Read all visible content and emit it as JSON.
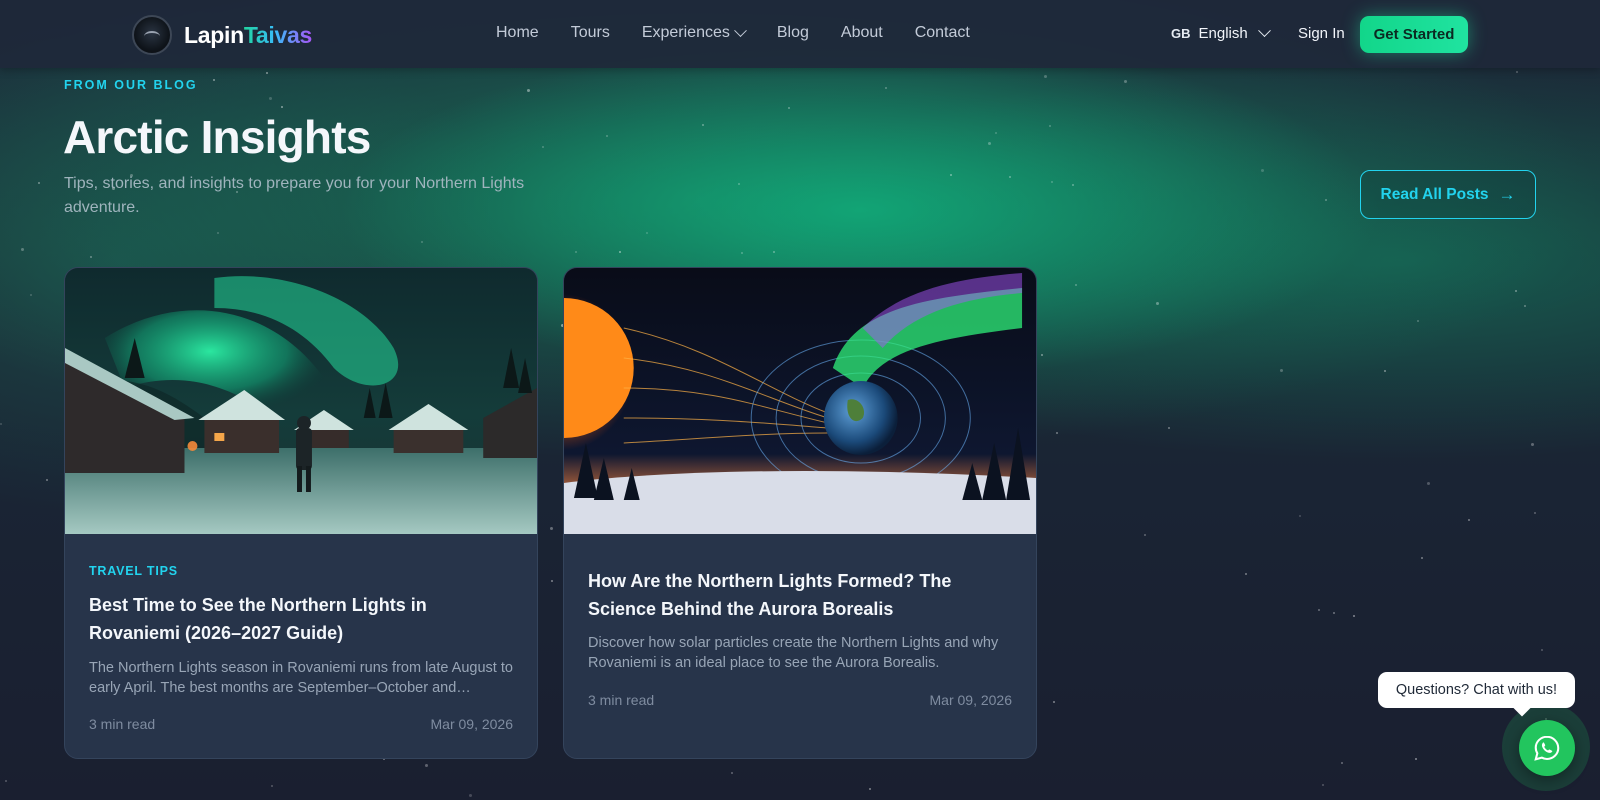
{
  "nav": {
    "logo_part1": "Lapin",
    "logo_part2": "Taivas",
    "menu": [
      {
        "label": "Home"
      },
      {
        "label": "Tours"
      },
      {
        "label": "Experiences"
      },
      {
        "label": "Blog"
      },
      {
        "label": "About"
      },
      {
        "label": "Contact"
      }
    ],
    "language_code": "GB",
    "language": "English",
    "sign_in": "Sign In",
    "get_started": "Get Started"
  },
  "section": {
    "eyebrow": "FROM OUR BLOG",
    "title": "Arctic Insights",
    "subtitle": "Tips, stories, and insights to prepare you for your Northern Lights adventure.",
    "read_all": "Read All Posts",
    "read_all_arrow": "→"
  },
  "posts": [
    {
      "category": "TRAVEL TIPS",
      "title": "Best Time to See the Northern Lights in Rovaniemi (2026–2027 Guide)",
      "excerpt": "The Northern Lights season in Rovaniemi runs from late August to early April. The best months are September–October and November–March when skies are darkest.",
      "read_time": "3 min read",
      "date": "Mar 09, 2026",
      "image_icon": "aurora-village-photo"
    },
    {
      "category": "",
      "title": "How Are the Northern Lights Formed? The Science Behind the Aurora Borealis",
      "excerpt": "Discover how solar particles create the Northern Lights and why Rovaniemi is an ideal place to see the Aurora Borealis.",
      "read_time": "3 min read",
      "date": "Mar 09, 2026",
      "image_icon": "sun-earth-aurora-illustration"
    }
  ],
  "chat": {
    "prompt": "Questions? Chat with us!",
    "icon": "whatsapp-icon"
  },
  "colors": {
    "accent_cyan": "#22d3ee",
    "accent_green": "#20e3a0",
    "card_bg": "#27344a",
    "whatsapp": "#22c55e"
  }
}
